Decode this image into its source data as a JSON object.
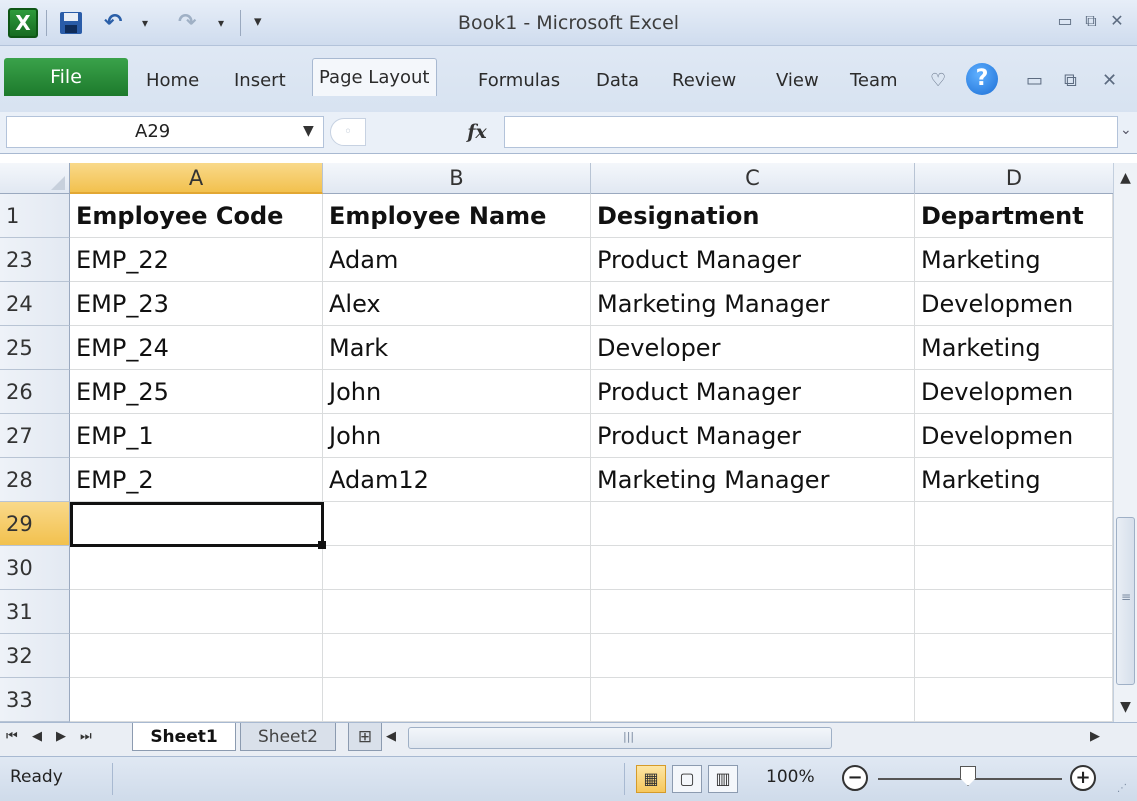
{
  "window": {
    "title": "Book1 - Microsoft Excel",
    "app_icon": "X"
  },
  "quick_access": {
    "icons": [
      "save-icon",
      "undo-icon",
      "redo-icon",
      "customize-icon"
    ]
  },
  "ribbon": {
    "file_label": "File",
    "tabs": [
      "Home",
      "Insert",
      "Page Layout",
      "Formulas",
      "Data",
      "Review",
      "View",
      "Team"
    ],
    "active_tab": "Page Layout",
    "help_glyph": "?"
  },
  "formula_bar": {
    "name_box": "A29",
    "fx_label": "fx",
    "formula": ""
  },
  "grid": {
    "column_headers": [
      "A",
      "B",
      "C",
      "D"
    ],
    "selected_column": "A",
    "rows": [
      {
        "num": "1",
        "cells": [
          "Employee Code",
          "Employee Name",
          "Designation",
          "Department"
        ],
        "header": true
      },
      {
        "num": "23",
        "cells": [
          "EMP_22",
          "Adam",
          "Product Manager",
          "Marketing"
        ]
      },
      {
        "num": "24",
        "cells": [
          "EMP_23",
          "Alex",
          "Marketing Manager",
          "Developmen"
        ]
      },
      {
        "num": "25",
        "cells": [
          "EMP_24",
          "Mark",
          "Developer",
          "Marketing"
        ]
      },
      {
        "num": "26",
        "cells": [
          "EMP_25",
          "John",
          "Product Manager",
          "Developmen"
        ]
      },
      {
        "num": "27",
        "cells": [
          "EMP_1",
          "John",
          "Product Manager",
          "Developmen"
        ]
      },
      {
        "num": "28",
        "cells": [
          "EMP_2",
          "Adam12",
          "Marketing Manager",
          "Marketing"
        ]
      },
      {
        "num": "29",
        "cells": [
          "",
          "",
          "",
          ""
        ],
        "selected": true
      },
      {
        "num": "30",
        "cells": [
          "",
          "",
          "",
          ""
        ]
      },
      {
        "num": "31",
        "cells": [
          "",
          "",
          "",
          ""
        ]
      },
      {
        "num": "32",
        "cells": [
          "",
          "",
          "",
          ""
        ]
      },
      {
        "num": "33",
        "cells": [
          "",
          "",
          "",
          ""
        ]
      }
    ]
  },
  "sheet_tabs": {
    "tabs": [
      "Sheet1",
      "Sheet2"
    ],
    "active": "Sheet1"
  },
  "status_bar": {
    "mode": "Ready",
    "zoom": "100%",
    "zoom_minus": "−",
    "zoom_plus": "+"
  },
  "colors": {
    "accent": "#1d7a2c",
    "selection": "#f2c14e"
  }
}
